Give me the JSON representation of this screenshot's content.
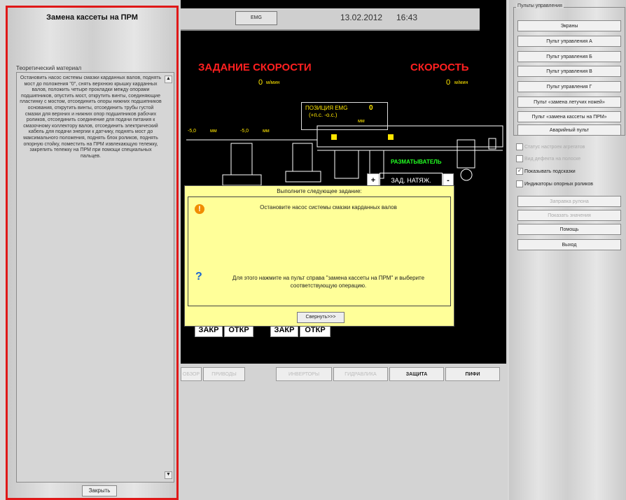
{
  "left_panel": {
    "title": "Замена кассеты на ПРМ",
    "theory_label": "Теоретический материал",
    "theory_text": "Остановить насос системы смазки карданных валов, поднять мост до положения \"0\", снять верхнюю крышку карданных валов, положить четыре прокладки между опорами подшипников, опустить мост, открутить винты, соединяющие пластинку с мостом, отсоединить опоры нижних подшипников основания, открутить винты, отсоединить трубы густой смазки для верхних и нижних опор подшипников рабочих роликов, отсоединить соединение для подачи питания к смазочному коллектору валов, отсоединить электрический кабель для подачи энергии к датчику, поднять мост до максимального положения, поднять блок роликов, поднять опорную стойку, поместить на ПРМ извлекающую тележку, закрепить тележку на ПРМ при помощи специальных пальцев.",
    "close_button": "Закрыть"
  },
  "header": {
    "emg_button": "EMG",
    "date": "13.02.2012",
    "time": "16:43"
  },
  "screen": {
    "speed_task_label": "ЗАДАНИЕ СКОРОСТИ",
    "speed_task_value": "0",
    "speed_task_unit": "м/мин",
    "speed_label": "СКОРОСТЬ",
    "speed_value": "0",
    "speed_unit": "м/мин",
    "position_label": "ПОЗИЦИЯ EMG",
    "position_value": "0",
    "position_range": "(+п.с.  -о.с.)",
    "position_unit": "мм",
    "unwinder_label": "РАЗМАТЫВАТЕЛЬ",
    "tension_label": "ЗАД. НАТЯЖ.",
    "plus_label": "+",
    "minus_label": "-",
    "marker_1": "-5,0",
    "marker_1_unit": "мм",
    "marker_2": "-5,0",
    "marker_2_unit": "мм",
    "close_1": "ЗАКР",
    "open_1": "ОТКР",
    "close_2": "ЗАКР",
    "open_2": "ОТКР"
  },
  "dialog": {
    "title": "Выполните следующее задание:",
    "task": "Остановите насос системы смазки карданных валов",
    "hint": "Для этого нажмите на пульт справа \"замена кассеты на ПРМ\" и выберите соответствующую операцию.",
    "collapse_button": "Свернуть>>>"
  },
  "tabs": [
    {
      "label": "ОБЗОР",
      "active": false
    },
    {
      "label": "ПРИВОДЫ",
      "active": false
    },
    {
      "label": "ИНВЕРТОРЫ",
      "active": false
    },
    {
      "label": "ГИДРАВЛИКА",
      "active": false
    },
    {
      "label": "ЗАЩИТА",
      "active": true
    },
    {
      "label": "ПИФИ",
      "active": true
    }
  ],
  "right_panel": {
    "group_label": "Пульты управления",
    "buttons": [
      "Экраны",
      "Пульт управления А",
      "Пульт управления Б",
      "Пульт управления В",
      "Пульт управления Г",
      "Пульт «замена летучих ножей»",
      "Пульт «замена кассеты на ПРМ»",
      "Аварийный пульт"
    ],
    "checks": [
      {
        "label": "Статус настроек агрегатов",
        "checked": false,
        "enabled": false
      },
      {
        "label": "Вид дефекта на полоске",
        "checked": false,
        "enabled": false
      },
      {
        "label": "Показывать подсказки",
        "checked": true,
        "enabled": true
      },
      {
        "label": "Индикаторы опорных роликов",
        "checked": false,
        "enabled": true
      }
    ],
    "refill_button": "Заправка рулона",
    "show_marks_button": "Показать значения",
    "help_button": "Помощь",
    "exit_button": "Выход"
  }
}
